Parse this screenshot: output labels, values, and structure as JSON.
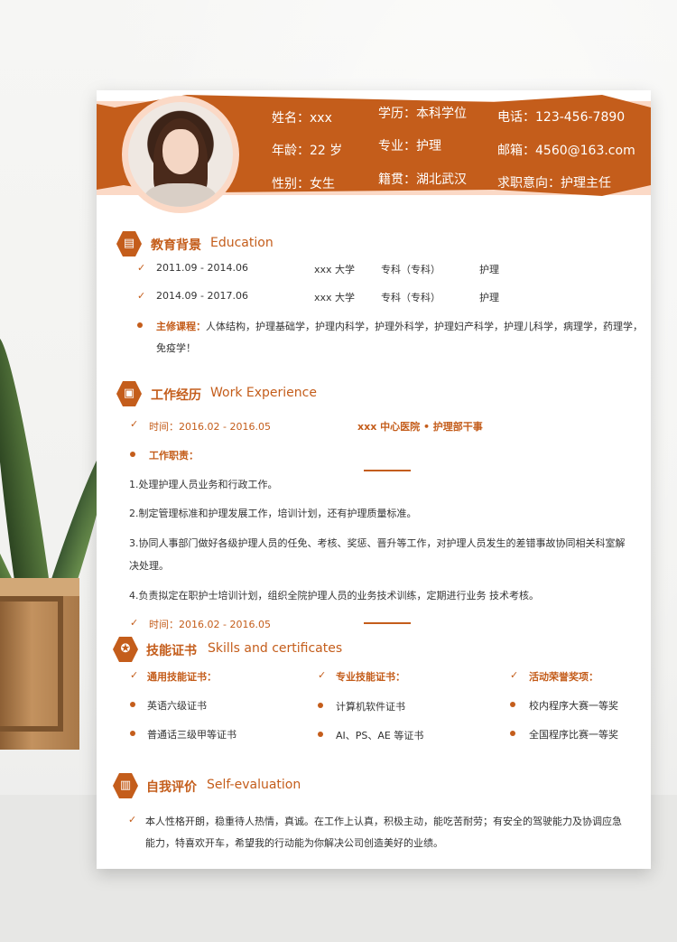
{
  "header": {
    "name": "姓名：xxx",
    "age": "年龄：22 岁",
    "gender": "性别：女生",
    "education": "学历：本科学位",
    "major": "专业：护理",
    "hometown": "籍贯：湖北武汉",
    "phone": "电话：123-456-7890",
    "email": "邮箱：4560@163.com",
    "intention": "求职意向：护理主任"
  },
  "education": {
    "title": "教育背景",
    "title_en": "Education",
    "rows": [
      {
        "period": "2011.09 - 2014.06",
        "school": "xxx 大学",
        "degree": "专科（专科）",
        "major": "护理"
      },
      {
        "period": "2014.09 - 2017.06",
        "school": "xxx 大学",
        "degree": "专科（专科）",
        "major": "护理"
      }
    ],
    "courses_label": "主修课程：",
    "courses_line1": "人体结构，护理基础学，护理内科学，护理外科学，护理妇产科学，护理儿科学，病理学，药理学，",
    "courses_line2": "免疫学！"
  },
  "work": {
    "title": "工作经历",
    "title_en": "Work Experience",
    "time1": "时间：2016.02 - 2016.05",
    "org1": "xxx 中心医院 • 护理部干事",
    "duty_label": "工作职责：",
    "duties": [
      "1.处理护理人员业务和行政工作。",
      "2.制定管理标准和护理发展工作，培训计划，还有护理质量标准。",
      "3.协同人事部门做好各级护理人员的任免、考核、奖惩、晋升等工作，对护理人员发生的差错事故协同相关科室解",
      "决处理。",
      "4.负责拟定在职护士培训计划，组织全院护理人员的业务技术训练，定期进行业务  技术考核。"
    ],
    "time2": "时间：2016.02 - 2016.05"
  },
  "skills": {
    "title": "技能证书",
    "title_en": "Skills and certificates",
    "col1_label": "通用技能证书：",
    "col1_items": [
      "英语六级证书",
      "普通话三级甲等证书"
    ],
    "col2_label": "专业技能证书：",
    "col2_items": [
      "计算机软件证书",
      "AI、PS、AE 等证书"
    ],
    "col3_label": "活动荣誉奖项：",
    "col3_items": [
      "校内程序大赛一等奖",
      "全国程序比赛一等奖"
    ]
  },
  "self": {
    "title": "自我评价",
    "title_en": "Self-evaluation",
    "line1": "本人性格开朗，稳重待人热情，真诚。在工作上认真，积极主动，能吃苦耐劳；有安全的驾驶能力及协调应急",
    "line2": "能力，特喜欢开车，希望我的行动能为你解决公司创造美好的业绩。"
  },
  "colors": {
    "accent": "#c45d1b",
    "accent_light": "#fbd9c6"
  },
  "icons": [
    "id-card-icon",
    "briefcase-icon",
    "certificate-icon",
    "chart-icon",
    "check-icon"
  ]
}
